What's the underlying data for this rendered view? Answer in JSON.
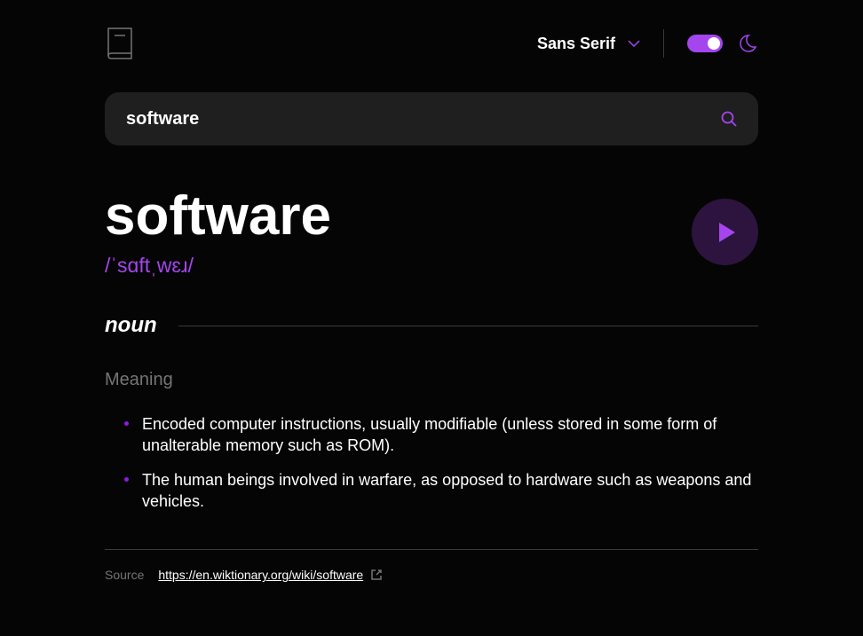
{
  "header": {
    "font_selector_label": "Sans Serif"
  },
  "search": {
    "value": "software"
  },
  "word": {
    "title": "software",
    "phonetic": "/ˈsɑftˌwɛɹ/"
  },
  "part_of_speech": "noun",
  "meaning_label": "Meaning",
  "meanings": [
    "Encoded computer instructions, usually modifiable (unless stored in some form of unalterable memory such as ROM).",
    "The human beings involved in warfare, as opposed to hardware such as weapons and vehicles."
  ],
  "source": {
    "label": "Source",
    "url": "https://en.wiktionary.org/wiki/software"
  },
  "colors": {
    "accent": "#a445ed",
    "bg": "#050505",
    "input_bg": "#1f1f1f",
    "muted": "#757575"
  }
}
